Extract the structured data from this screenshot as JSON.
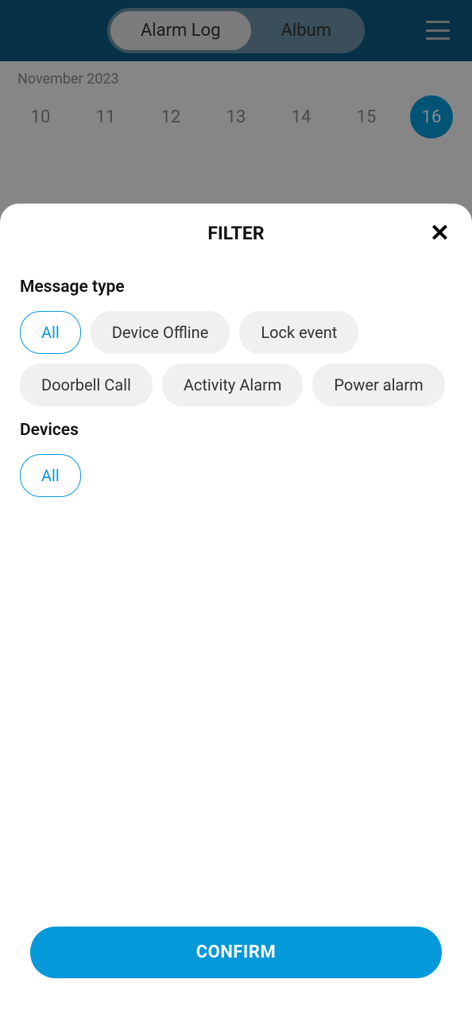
{
  "header": {
    "tabs": [
      {
        "label": "Alarm Log",
        "active": true
      },
      {
        "label": "Album",
        "active": false
      }
    ]
  },
  "dateSection": {
    "month": "November 2023",
    "dates": [
      {
        "day": "10",
        "selected": false
      },
      {
        "day": "11",
        "selected": false
      },
      {
        "day": "12",
        "selected": false
      },
      {
        "day": "13",
        "selected": false
      },
      {
        "day": "14",
        "selected": false
      },
      {
        "day": "15",
        "selected": false
      },
      {
        "day": "16",
        "selected": true
      }
    ]
  },
  "filter": {
    "title": "FILTER",
    "messageTypeLabel": "Message type",
    "messageTypes": [
      {
        "label": "All",
        "selected": true
      },
      {
        "label": "Device Offline",
        "selected": false
      },
      {
        "label": "Lock event",
        "selected": false
      },
      {
        "label": "Doorbell Call",
        "selected": false
      },
      {
        "label": "Activity Alarm",
        "selected": false
      },
      {
        "label": "Power alarm",
        "selected": false
      }
    ],
    "devicesLabel": "Devices",
    "devices": [
      {
        "label": "All",
        "selected": true
      }
    ],
    "confirmLabel": "CONFIRM"
  }
}
